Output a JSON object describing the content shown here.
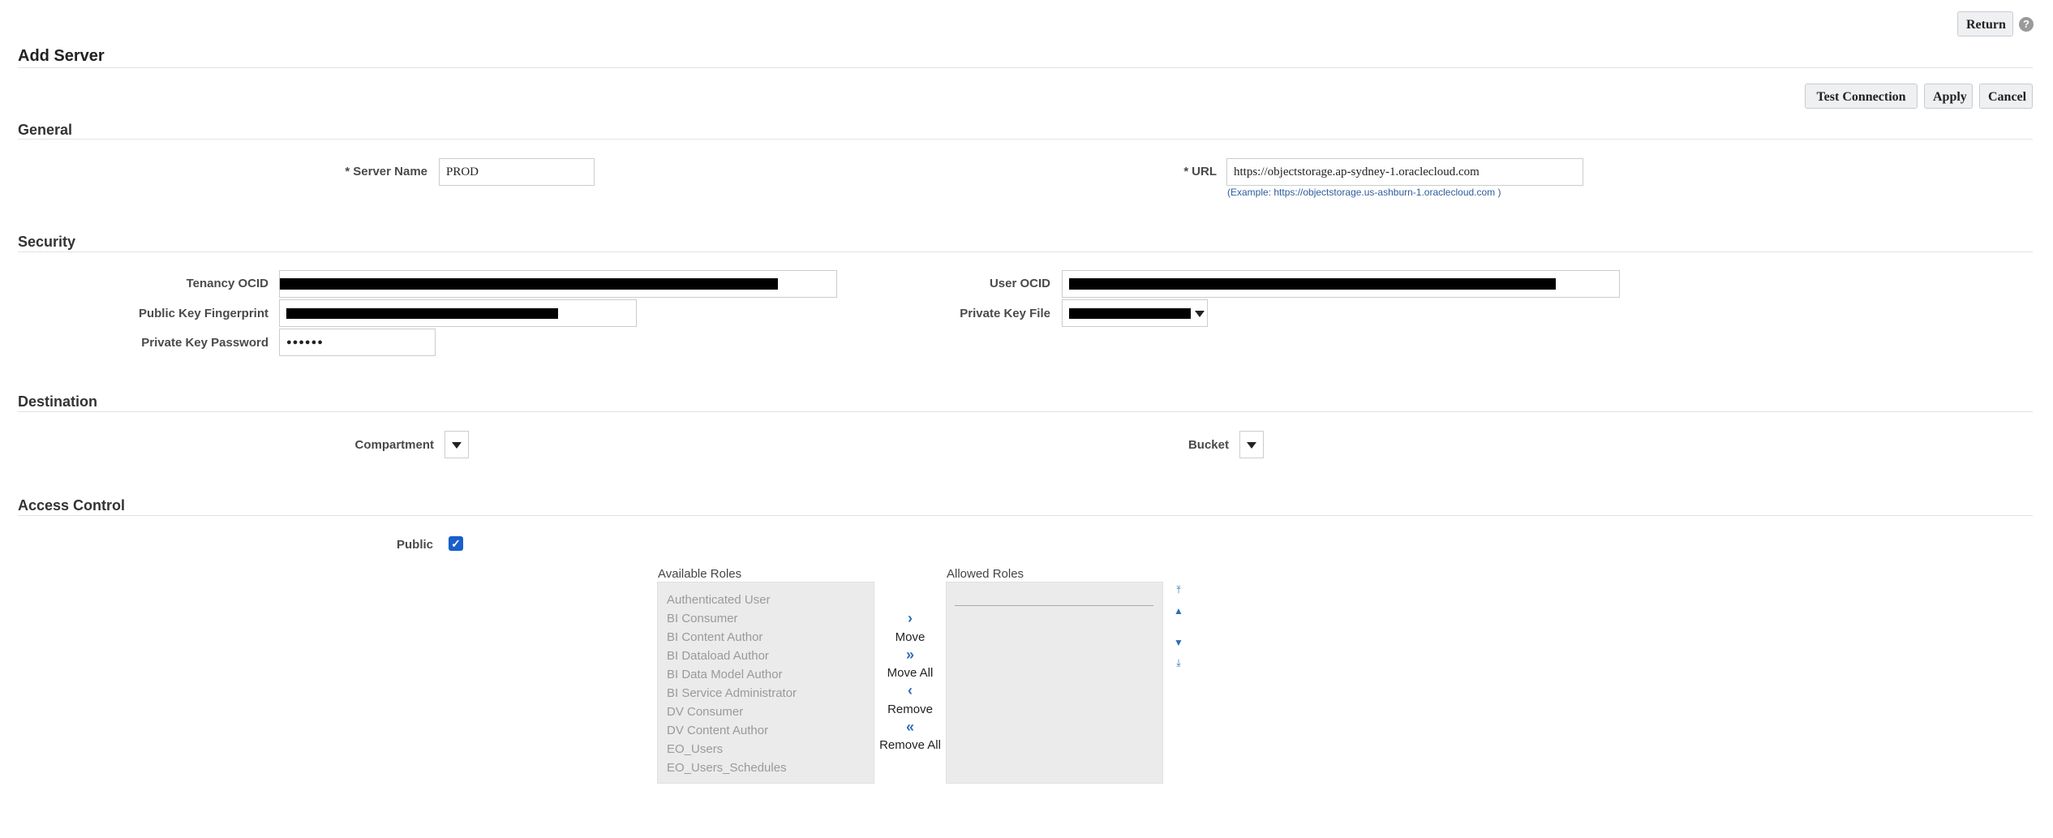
{
  "header": {
    "return_label": "Return",
    "help_icon": "help-icon"
  },
  "page": {
    "title": "Add Server"
  },
  "actions": {
    "test_connection": "Test Connection",
    "apply": "Apply",
    "cancel": "Cancel"
  },
  "general": {
    "title": "General",
    "server_name_label": "Server Name",
    "server_name_value": "PROD",
    "url_label": "URL",
    "url_value": "https://objectstorage.ap-sydney-1.oraclecloud.com",
    "url_hint": "(Example: https://objectstorage.us-ashburn-1.oraclecloud.com )",
    "required_marker": "*"
  },
  "security": {
    "title": "Security",
    "tenancy_label": "Tenancy OCID",
    "fingerprint_label": "Public Key Fingerprint",
    "password_label": "Private Key Password",
    "password_value": "●●●●●●",
    "user_ocid_label": "User OCID",
    "key_file_label": "Private Key File"
  },
  "destination": {
    "title": "Destination",
    "compartment_label": "Compartment",
    "bucket_label": "Bucket"
  },
  "access": {
    "title": "Access Control",
    "public_label": "Public",
    "public_checked": true,
    "available_label": "Available Roles",
    "allowed_label": "Allowed Roles",
    "available_roles": [
      "Authenticated User",
      "BI Consumer",
      "BI Content Author",
      "BI Dataload Author",
      "BI Data Model Author",
      "BI Service Administrator",
      "DV Consumer",
      "DV Content Author",
      "EO_Users",
      "EO_Users_Schedules"
    ],
    "move": "Move",
    "move_all": "Move All",
    "remove": "Remove",
    "remove_all": "Remove All"
  },
  "colors": {
    "accent": "#2e6db7",
    "checkbox": "#1a5fcc"
  }
}
